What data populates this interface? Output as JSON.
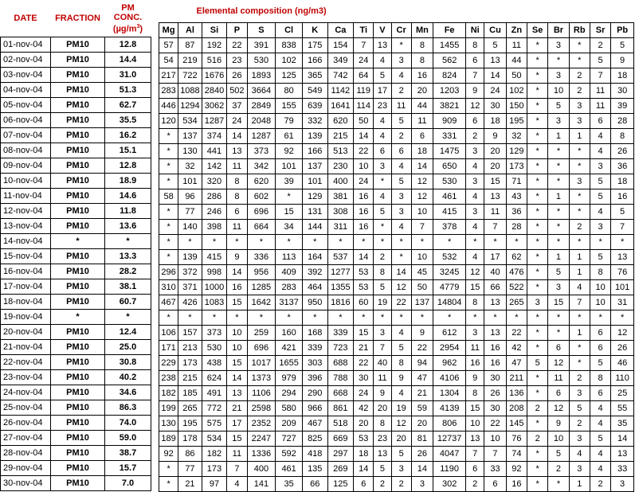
{
  "headers": {
    "date": "DATE",
    "fraction": "FRACTION",
    "conc_line1": "PM",
    "conc_line2": "CONC.",
    "conc_unit": "(µg/m",
    "conc_unit_sup": "3",
    "conc_unit_end": ")",
    "composition_title": "Elemental composition (ng/m3)"
  },
  "elements": [
    "Mg",
    "Al",
    "Si",
    "P",
    "S",
    "Cl",
    "K",
    "Ca",
    "Ti",
    "V",
    "Cr",
    "Mn",
    "Fe",
    "Ni",
    "Cu",
    "Zn",
    "Se",
    "Br",
    "Rb",
    "Sr",
    "Pb"
  ],
  "rows": [
    {
      "date": "01-nov-04",
      "fraction": "PM10",
      "conc": "12.8",
      "values": [
        "57",
        "87",
        "192",
        "22",
        "391",
        "838",
        "175",
        "154",
        "7",
        "13",
        "*",
        "8",
        "1455",
        "8",
        "5",
        "11",
        "*",
        "3",
        "*",
        "2",
        "5"
      ]
    },
    {
      "date": "02-nov-04",
      "fraction": "PM10",
      "conc": "14.4",
      "values": [
        "54",
        "219",
        "516",
        "23",
        "530",
        "102",
        "166",
        "349",
        "24",
        "4",
        "3",
        "8",
        "562",
        "6",
        "13",
        "44",
        "*",
        "*",
        "*",
        "5",
        "9"
      ]
    },
    {
      "date": "03-nov-04",
      "fraction": "PM10",
      "conc": "31.0",
      "values": [
        "217",
        "722",
        "1676",
        "26",
        "1893",
        "125",
        "365",
        "742",
        "64",
        "5",
        "4",
        "16",
        "824",
        "7",
        "14",
        "50",
        "*",
        "3",
        "2",
        "7",
        "18"
      ]
    },
    {
      "date": "04-nov-04",
      "fraction": "PM10",
      "conc": "51.3",
      "values": [
        "283",
        "1088",
        "2840",
        "502",
        "3664",
        "80",
        "549",
        "1142",
        "119",
        "17",
        "2",
        "20",
        "1203",
        "9",
        "24",
        "102",
        "*",
        "10",
        "2",
        "11",
        "30"
      ]
    },
    {
      "date": "05-nov-04",
      "fraction": "PM10",
      "conc": "62.7",
      "values": [
        "446",
        "1294",
        "3062",
        "37",
        "2849",
        "155",
        "639",
        "1641",
        "114",
        "23",
        "11",
        "44",
        "3821",
        "12",
        "30",
        "150",
        "*",
        "5",
        "3",
        "11",
        "39"
      ]
    },
    {
      "date": "06-nov-04",
      "fraction": "PM10",
      "conc": "35.5",
      "values": [
        "120",
        "534",
        "1287",
        "24",
        "2048",
        "79",
        "332",
        "620",
        "50",
        "4",
        "5",
        "11",
        "909",
        "6",
        "18",
        "195",
        "*",
        "3",
        "3",
        "6",
        "28"
      ]
    },
    {
      "date": "07-nov-04",
      "fraction": "PM10",
      "conc": "16.2",
      "values": [
        "*",
        "137",
        "374",
        "14",
        "1287",
        "61",
        "139",
        "215",
        "14",
        "4",
        "2",
        "6",
        "331",
        "2",
        "9",
        "32",
        "*",
        "1",
        "1",
        "4",
        "8"
      ]
    },
    {
      "date": "08-nov-04",
      "fraction": "PM10",
      "conc": "15.1",
      "values": [
        "*",
        "130",
        "441",
        "13",
        "373",
        "92",
        "166",
        "513",
        "22",
        "6",
        "6",
        "18",
        "1475",
        "3",
        "20",
        "129",
        "*",
        "*",
        "*",
        "4",
        "26"
      ]
    },
    {
      "date": "09-nov-04",
      "fraction": "PM10",
      "conc": "12.8",
      "values": [
        "*",
        "32",
        "142",
        "11",
        "342",
        "101",
        "137",
        "230",
        "10",
        "3",
        "4",
        "14",
        "650",
        "4",
        "20",
        "173",
        "*",
        "*",
        "*",
        "3",
        "36"
      ]
    },
    {
      "date": "10-nov-04",
      "fraction": "PM10",
      "conc": "18.9",
      "values": [
        "*",
        "101",
        "320",
        "8",
        "620",
        "39",
        "101",
        "400",
        "24",
        "*",
        "5",
        "12",
        "530",
        "3",
        "15",
        "71",
        "*",
        "*",
        "3",
        "5",
        "18"
      ]
    },
    {
      "date": "11-nov-04",
      "fraction": "PM10",
      "conc": "14.6",
      "values": [
        "58",
        "96",
        "286",
        "8",
        "602",
        "*",
        "129",
        "381",
        "16",
        "4",
        "3",
        "12",
        "461",
        "4",
        "13",
        "43",
        "*",
        "1",
        "*",
        "5",
        "16"
      ]
    },
    {
      "date": "12-nov-04",
      "fraction": "PM10",
      "conc": "11.8",
      "values": [
        "*",
        "77",
        "246",
        "6",
        "696",
        "15",
        "131",
        "308",
        "16",
        "5",
        "3",
        "10",
        "415",
        "3",
        "11",
        "36",
        "*",
        "*",
        "*",
        "4",
        "5"
      ]
    },
    {
      "date": "13-nov-04",
      "fraction": "PM10",
      "conc": "13.6",
      "values": [
        "*",
        "140",
        "398",
        "11",
        "664",
        "34",
        "144",
        "311",
        "16",
        "*",
        "4",
        "7",
        "378",
        "4",
        "7",
        "28",
        "*",
        "*",
        "2",
        "3",
        "7"
      ]
    },
    {
      "date": "14-nov-04",
      "fraction": "*",
      "conc": "*",
      "values": [
        "*",
        "*",
        "*",
        "*",
        "*",
        "*",
        "*",
        "*",
        "*",
        "*",
        "*",
        "*",
        "*",
        "*",
        "*",
        "*",
        "*",
        "*",
        "*",
        "*",
        "*"
      ]
    },
    {
      "date": "15-nov-04",
      "fraction": "PM10",
      "conc": "13.3",
      "values": [
        "*",
        "139",
        "415",
        "9",
        "336",
        "113",
        "164",
        "537",
        "14",
        "2",
        "*",
        "10",
        "532",
        "4",
        "17",
        "62",
        "*",
        "1",
        "1",
        "5",
        "13"
      ]
    },
    {
      "date": "16-nov-04",
      "fraction": "PM10",
      "conc": "28.2",
      "values": [
        "296",
        "372",
        "998",
        "14",
        "956",
        "409",
        "392",
        "1277",
        "53",
        "8",
        "14",
        "45",
        "3245",
        "12",
        "40",
        "476",
        "*",
        "5",
        "1",
        "8",
        "76"
      ]
    },
    {
      "date": "17-nov-04",
      "fraction": "PM10",
      "conc": "38.1",
      "values": [
        "310",
        "371",
        "1000",
        "16",
        "1285",
        "283",
        "464",
        "1355",
        "53",
        "5",
        "12",
        "50",
        "4779",
        "15",
        "66",
        "522",
        "*",
        "3",
        "4",
        "10",
        "101"
      ]
    },
    {
      "date": "18-nov-04",
      "fraction": "PM10",
      "conc": "60.7",
      "values": [
        "467",
        "426",
        "1083",
        "15",
        "1642",
        "3137",
        "950",
        "1816",
        "60",
        "19",
        "22",
        "137",
        "14804",
        "8",
        "13",
        "265",
        "3",
        "15",
        "7",
        "10",
        "31"
      ]
    },
    {
      "date": "19-nov-04",
      "fraction": "*",
      "conc": "*",
      "values": [
        "*",
        "*",
        "*",
        "*",
        "*",
        "*",
        "*",
        "*",
        "*",
        "*",
        "*",
        "*",
        "*",
        "*",
        "*",
        "*",
        "*",
        "*",
        "*",
        "*",
        "*"
      ]
    },
    {
      "date": "20-nov-04",
      "fraction": "PM10",
      "conc": "12.4",
      "values": [
        "106",
        "157",
        "373",
        "10",
        "259",
        "160",
        "168",
        "339",
        "15",
        "3",
        "4",
        "9",
        "612",
        "3",
        "13",
        "22",
        "*",
        "*",
        "1",
        "6",
        "12"
      ]
    },
    {
      "date": "21-nov-04",
      "fraction": "PM10",
      "conc": "25.0",
      "values": [
        "171",
        "213",
        "530",
        "10",
        "696",
        "421",
        "339",
        "723",
        "21",
        "7",
        "5",
        "22",
        "2954",
        "11",
        "16",
        "42",
        "*",
        "6",
        "*",
        "6",
        "26"
      ]
    },
    {
      "date": "22-nov-04",
      "fraction": "PM10",
      "conc": "30.8",
      "values": [
        "229",
        "173",
        "438",
        "15",
        "1017",
        "1655",
        "303",
        "688",
        "22",
        "40",
        "8",
        "94",
        "962",
        "16",
        "16",
        "47",
        "5",
        "12",
        "*",
        "5",
        "46"
      ]
    },
    {
      "date": "23-nov-04",
      "fraction": "PM10",
      "conc": "40.2",
      "values": [
        "238",
        "215",
        "624",
        "14",
        "1373",
        "979",
        "396",
        "788",
        "30",
        "11",
        "9",
        "47",
        "4106",
        "9",
        "30",
        "211",
        "*",
        "11",
        "2",
        "8",
        "110"
      ]
    },
    {
      "date": "24-nov-04",
      "fraction": "PM10",
      "conc": "34.6",
      "values": [
        "182",
        "185",
        "491",
        "13",
        "1106",
        "294",
        "290",
        "668",
        "24",
        "9",
        "4",
        "21",
        "1304",
        "8",
        "26",
        "136",
        "*",
        "6",
        "3",
        "6",
        "25"
      ]
    },
    {
      "date": "25-nov-04",
      "fraction": "PM10",
      "conc": "86.3",
      "values": [
        "199",
        "265",
        "772",
        "21",
        "2598",
        "580",
        "966",
        "861",
        "42",
        "20",
        "19",
        "59",
        "4139",
        "15",
        "30",
        "208",
        "2",
        "12",
        "5",
        "4",
        "55"
      ]
    },
    {
      "date": "26-nov-04",
      "fraction": "PM10",
      "conc": "74.0",
      "values": [
        "130",
        "195",
        "575",
        "17",
        "2352",
        "209",
        "467",
        "518",
        "20",
        "8",
        "12",
        "20",
        "806",
        "10",
        "22",
        "145",
        "*",
        "9",
        "2",
        "4",
        "35"
      ]
    },
    {
      "date": "27-nov-04",
      "fraction": "PM10",
      "conc": "59.0",
      "values": [
        "189",
        "178",
        "534",
        "15",
        "2247",
        "727",
        "825",
        "669",
        "53",
        "23",
        "20",
        "81",
        "12737",
        "13",
        "10",
        "76",
        "2",
        "10",
        "3",
        "5",
        "14"
      ]
    },
    {
      "date": "28-nov-04",
      "fraction": "PM10",
      "conc": "38.7",
      "values": [
        "92",
        "86",
        "182",
        "11",
        "1336",
        "592",
        "418",
        "297",
        "18",
        "13",
        "5",
        "26",
        "4047",
        "7",
        "7",
        "74",
        "*",
        "5",
        "4",
        "4",
        "13"
      ]
    },
    {
      "date": "29-nov-04",
      "fraction": "PM10",
      "conc": "15.7",
      "values": [
        "*",
        "77",
        "173",
        "7",
        "400",
        "461",
        "135",
        "269",
        "14",
        "5",
        "3",
        "14",
        "1190",
        "6",
        "33",
        "92",
        "*",
        "2",
        "3",
        "4",
        "33"
      ]
    },
    {
      "date": "30-nov-04",
      "fraction": "PM10",
      "conc": "7.0",
      "values": [
        "*",
        "21",
        "97",
        "4",
        "141",
        "35",
        "66",
        "125",
        "6",
        "2",
        "2",
        "3",
        "302",
        "2",
        "6",
        "16",
        "*",
        "*",
        "1",
        "2",
        "3"
      ]
    }
  ]
}
